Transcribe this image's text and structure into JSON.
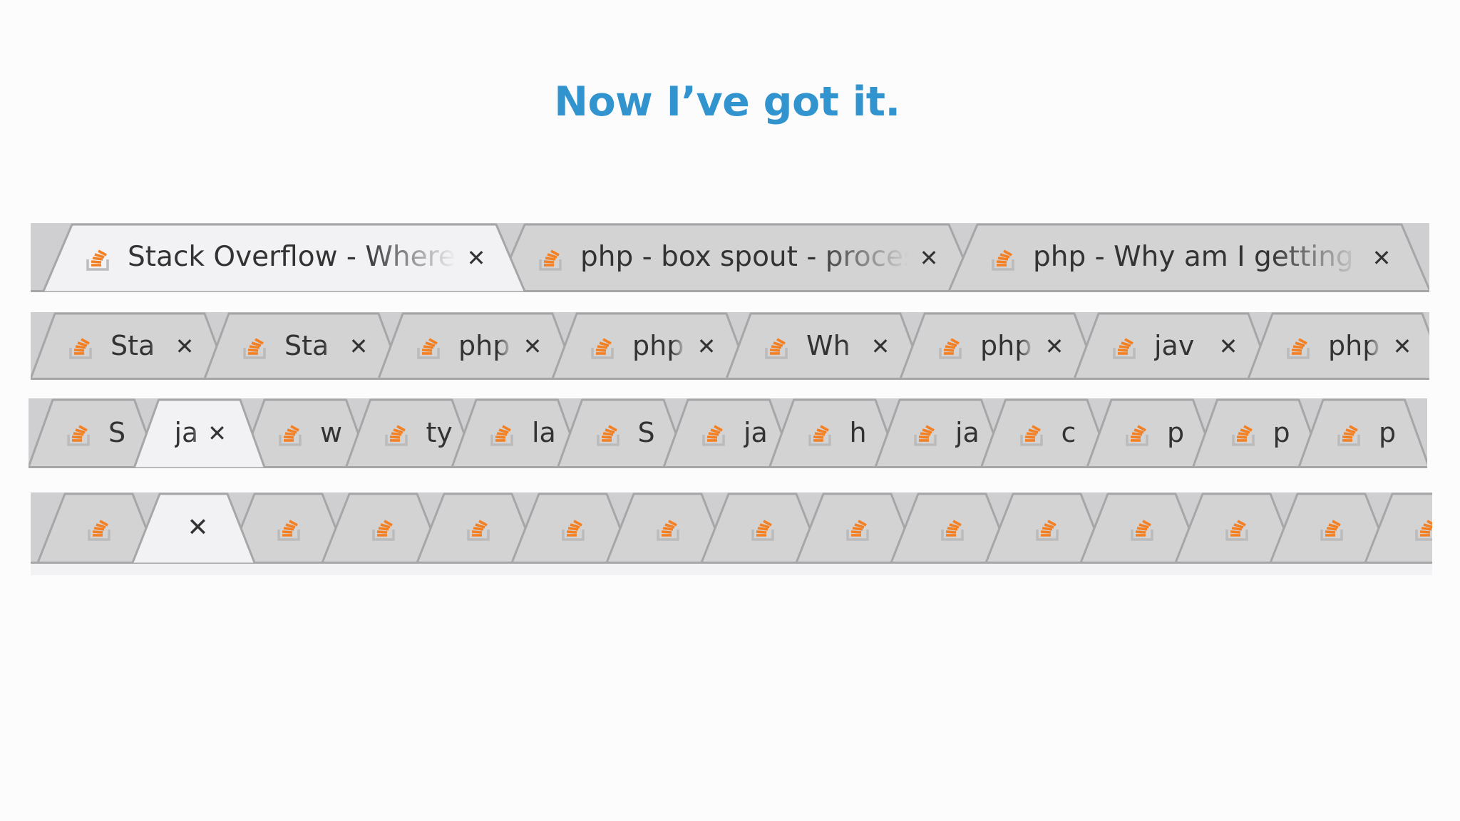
{
  "title": "Now I’ve got it.",
  "colors": {
    "title": "#3194cf",
    "tab_bg": "#d4d3d4",
    "tab_active": "#f2f1f3",
    "tab_border": "#a6a5a7",
    "strip_bg": "#cfced0",
    "icon_orange": "#f48024",
    "icon_gray": "#bcbbbb"
  },
  "icon_name": "stack-overflow-icon",
  "close_glyph": "✕",
  "rows": [
    {
      "name": "tab-row-1",
      "active": 0,
      "tabs": [
        {
          "label": "Stack Overflow - Where D"
        },
        {
          "label": "php - box spout - proces"
        },
        {
          "label": "php - Why am I getting (c"
        }
      ]
    },
    {
      "name": "tab-row-2",
      "active": -1,
      "tabs": [
        {
          "label": "Sta"
        },
        {
          "label": "Sta"
        },
        {
          "label": "php"
        },
        {
          "label": "php"
        },
        {
          "label": "Wh"
        },
        {
          "label": "php"
        },
        {
          "label": "jav"
        },
        {
          "label": "php"
        }
      ]
    },
    {
      "name": "tab-row-3",
      "active": 1,
      "tabs": [
        {
          "label": "S"
        },
        {
          "label": "ja"
        },
        {
          "label": "w"
        },
        {
          "label": "ty"
        },
        {
          "label": "la"
        },
        {
          "label": "S"
        },
        {
          "label": "ja"
        },
        {
          "label": "h"
        },
        {
          "label": "ja"
        },
        {
          "label": "c"
        },
        {
          "label": "p"
        },
        {
          "label": "p"
        },
        {
          "label": "p"
        }
      ]
    },
    {
      "name": "tab-row-4",
      "active": 1,
      "tabs": [
        {
          "label": ""
        },
        {
          "label": ""
        },
        {
          "label": ""
        },
        {
          "label": ""
        },
        {
          "label": ""
        },
        {
          "label": ""
        },
        {
          "label": ""
        },
        {
          "label": ""
        },
        {
          "label": ""
        },
        {
          "label": ""
        },
        {
          "label": ""
        },
        {
          "label": ""
        },
        {
          "label": ""
        },
        {
          "label": ""
        },
        {
          "label": ""
        }
      ]
    }
  ]
}
